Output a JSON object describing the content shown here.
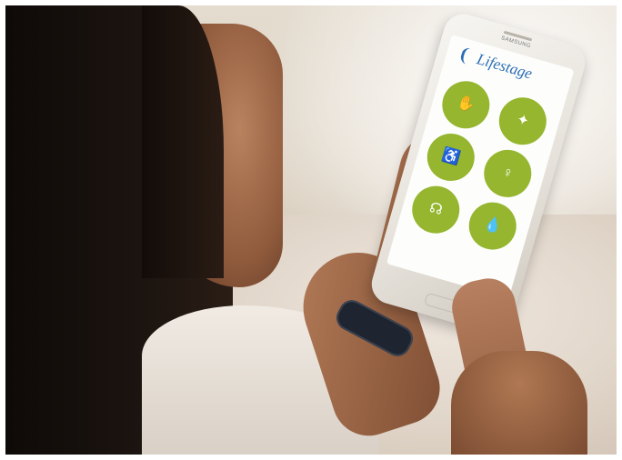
{
  "photo": {
    "description_tag": "woman-using-smartphone"
  },
  "phone": {
    "brand": "SAMSUNG",
    "app": {
      "logo_text": "Lifestage",
      "buttons": [
        {
          "icon": "hand-icon",
          "glyph": "✋"
        },
        {
          "icon": "sparkle-icon",
          "glyph": "✦"
        },
        {
          "icon": "walker-icon",
          "glyph": "♿"
        },
        {
          "icon": "person-icon",
          "glyph": "♀"
        },
        {
          "icon": "sock-icon",
          "glyph": "☊"
        },
        {
          "icon": "drop-icon",
          "glyph": "💧"
        }
      ]
    }
  },
  "colors": {
    "accent_green": "#95b62e",
    "logo_blue": "#2b6fb6"
  }
}
